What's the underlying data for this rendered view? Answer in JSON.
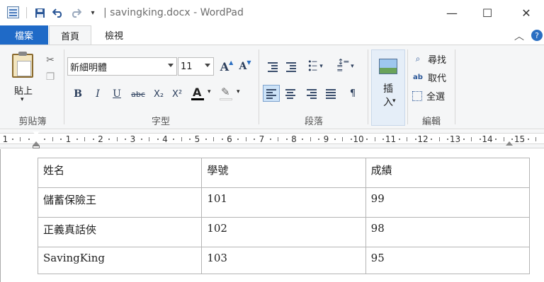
{
  "window": {
    "title": "| savingking.docx - WordPad",
    "minimize_glyph": "—",
    "maximize_glyph": "☐",
    "close_glyph": "✕"
  },
  "quick_access": {
    "items": [
      "save-icon",
      "undo-icon",
      "redo-icon",
      "customize-dropdown-icon"
    ]
  },
  "ribbon_tabs": {
    "file": "檔案",
    "home": "首頁",
    "view": "檢視"
  },
  "clipboard": {
    "paste": "貼上",
    "group": "剪貼簿"
  },
  "font": {
    "family": "新細明體",
    "size": "11",
    "group": "字型",
    "buttons": {
      "bold": "B",
      "italic": "I",
      "underline": "U",
      "strike": "abc",
      "subscript": "X₂",
      "superscript": "X²",
      "color": "A",
      "highlight": "✎"
    },
    "grow": "A",
    "shrink": "A"
  },
  "paragraph": {
    "group": "段落"
  },
  "insert": {
    "label": "插\n入"
  },
  "editing": {
    "find": "尋找",
    "replace": "取代",
    "select_all": "全選",
    "group": "編輯"
  },
  "ruler": {
    "numbers": [
      "1",
      "1",
      "2",
      "3",
      "4",
      "5",
      "6",
      "7",
      "8",
      "9",
      "10",
      "11",
      "12",
      "13",
      "14",
      "15"
    ]
  },
  "table": {
    "headers": [
      "姓名",
      "學號",
      "成績"
    ],
    "rows": [
      [
        "儲蓄保險王",
        "101",
        "99"
      ],
      [
        "正義真話俠",
        "102",
        "98"
      ],
      [
        "SavingKing",
        "103",
        "95"
      ]
    ]
  },
  "colors": {
    "file_tab": "#1f6ac7",
    "ribbon_bg": "#f5f6f7",
    "active_button": "#cde3f8"
  }
}
